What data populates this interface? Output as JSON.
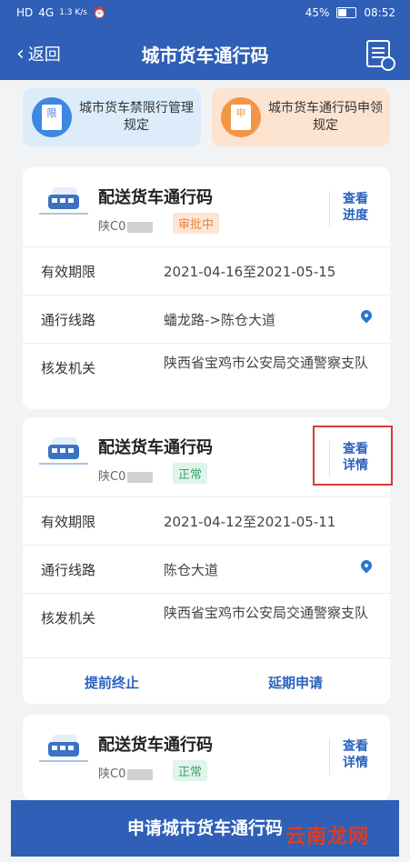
{
  "status": {
    "sim": "HD",
    "net": "4G",
    "speed": "1.3 K/s",
    "battery": "45%",
    "time": "08:52"
  },
  "header": {
    "back_label": "返回",
    "title": "城市货车通行码"
  },
  "quick_links": [
    {
      "badge": "限",
      "label": "城市货车禁限行管理规定"
    },
    {
      "badge": "申",
      "label": "城市货车通行码申领规定"
    }
  ],
  "labels": {
    "validity": "有效期限",
    "route": "通行线路",
    "issuer": "核发机关"
  },
  "cards": [
    {
      "title": "配送货车通行码",
      "plate": "陕C0",
      "status": "审批中",
      "action": "查看进度",
      "validity": "2021-04-16至2021-05-15",
      "route": "蟠龙路->陈仓大道",
      "issuer": "陕西省宝鸡市公安局交通警察支队"
    },
    {
      "title": "配送货车通行码",
      "plate": "陕C0",
      "status": "正常",
      "action": "查看详情",
      "validity": "2021-04-12至2021-05-11",
      "route": "陈仓大道",
      "issuer": "陕西省宝鸡市公安局交通警察支队",
      "buttons": [
        "提前终止",
        "延期申请"
      ]
    },
    {
      "title": "配送货车通行码",
      "plate": "陕C0",
      "status": "正常",
      "action": "查看详情"
    }
  ],
  "bottom_button": "申请城市货车通行码",
  "watermark": "云南龙网"
}
